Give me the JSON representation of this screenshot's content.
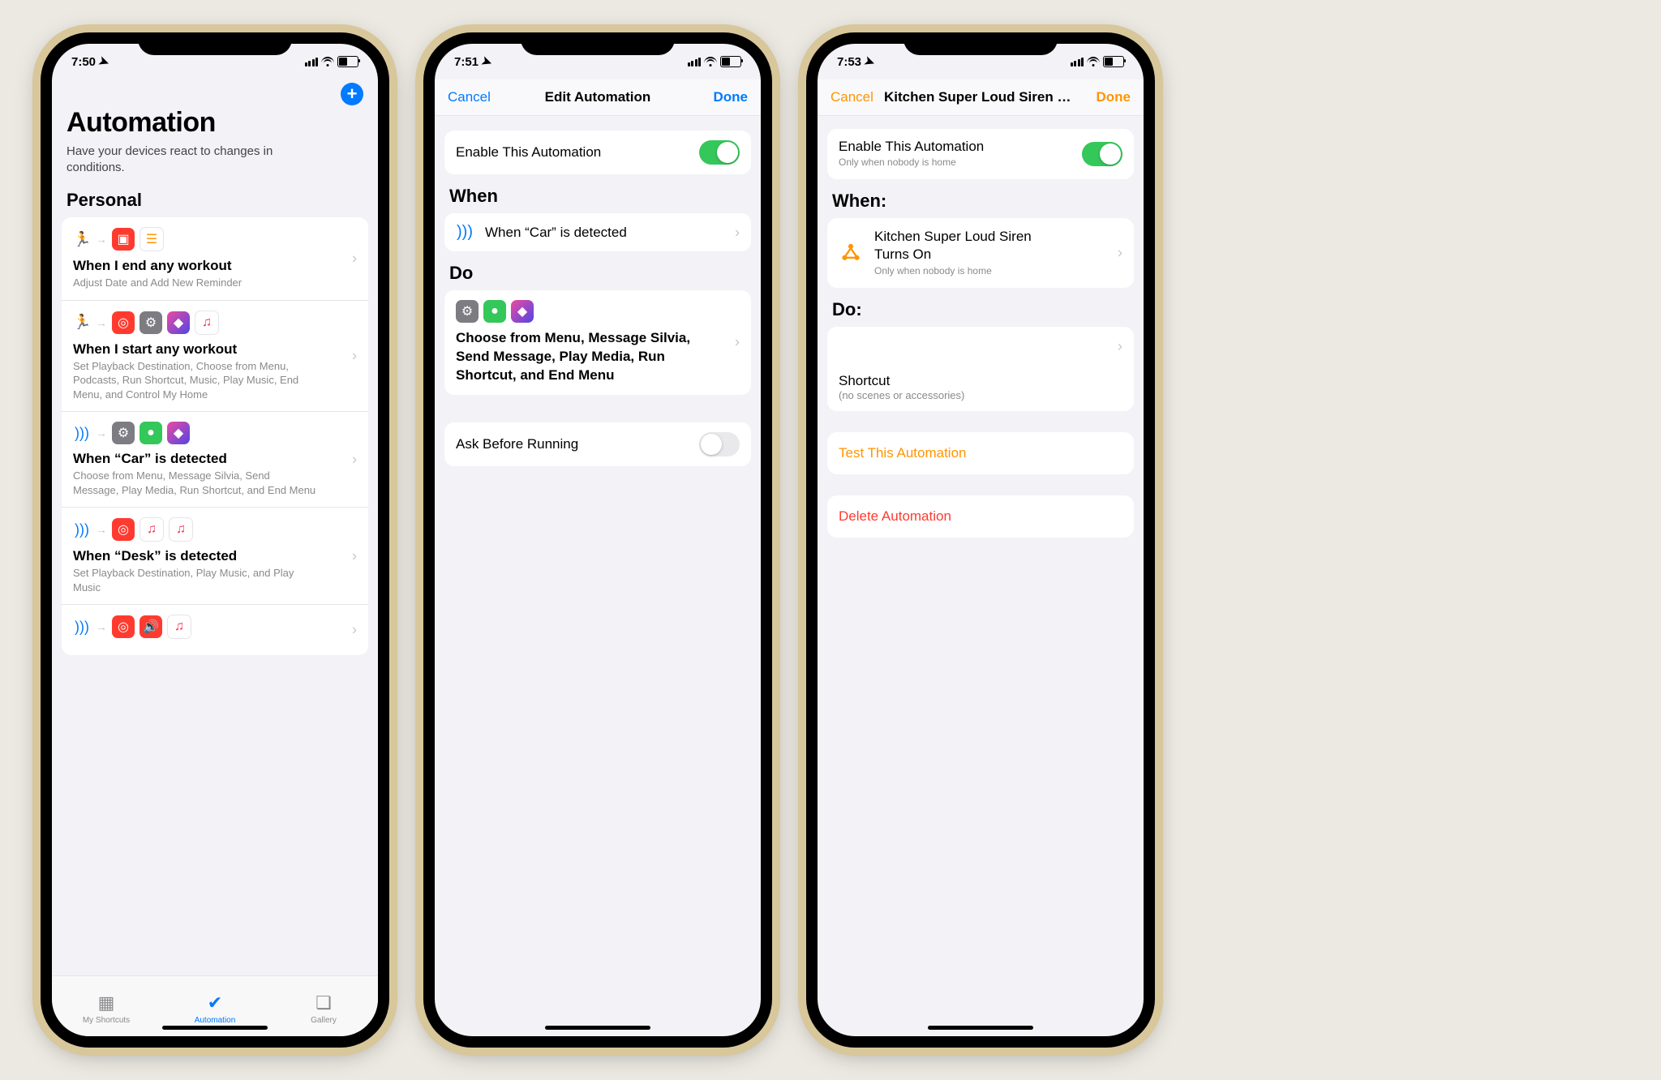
{
  "phone1": {
    "time": "7:50",
    "header_title": "Automation",
    "header_sub": "Have your devices react to changes in conditions.",
    "section": "Personal",
    "items": [
      {
        "title": "When I end any workout",
        "sub": "Adjust Date and Add New Reminder",
        "trigger": "runner",
        "apps": [
          "calendar",
          "reminders"
        ]
      },
      {
        "title": "When I start any workout",
        "sub": "Set Playback Destination, Choose from Menu, Podcasts, Run Shortcut, Music, Play Music, End Menu, and Control My Home",
        "trigger": "runner",
        "apps": [
          "airplay",
          "settings",
          "shortcuts",
          "music"
        ]
      },
      {
        "title": "When “Car” is detected",
        "sub": "Choose from Menu, Message Silvia, Send Message, Play Media, Run Shortcut, and End Menu",
        "trigger": "nfc",
        "apps": [
          "settings",
          "messages",
          "shortcuts"
        ]
      },
      {
        "title": "When “Desk” is detected",
        "sub": "Set Playback Destination, Play Music, and Play Music",
        "trigger": "nfc",
        "apps": [
          "airplay",
          "music",
          "music"
        ]
      },
      {
        "title": "",
        "sub": "",
        "trigger": "nfc",
        "apps": [
          "airplay",
          "sound",
          "music"
        ]
      }
    ],
    "tabs": {
      "shortcuts": "My Shortcuts",
      "automation": "Automation",
      "gallery": "Gallery"
    }
  },
  "phone2": {
    "time": "7:51",
    "cancel": "Cancel",
    "title": "Edit Automation",
    "done": "Done",
    "enable_label": "Enable This Automation",
    "when_h": "When",
    "when_text": "When “Car” is detected",
    "do_h": "Do",
    "do_text": "Choose from Menu, Message Silvia, Send Message, Play Media, Run Shortcut, and End Menu",
    "ask_label": "Ask Before Running"
  },
  "phone3": {
    "time": "7:53",
    "cancel": "Cancel",
    "title": "Kitchen Super Loud Siren Turn…",
    "done": "Done",
    "enable_label": "Enable This Automation",
    "enable_sub": "Only when nobody is home",
    "when_h": "When:",
    "when_title": "Kitchen Super Loud Siren Turns On",
    "when_sub": "Only when nobody is home",
    "do_h": "Do:",
    "shortcut_title": "Shortcut",
    "shortcut_sub": "(no scenes or accessories)",
    "test": "Test This Automation",
    "delete": "Delete Automation"
  },
  "icons": {
    "runner": "🏃",
    "nfc": ")))",
    "arrow": "→",
    "calendar": {
      "bg": "#ff3b30",
      "glyph": "▣"
    },
    "reminders": {
      "bg": "#fff",
      "border": true,
      "glyph": "☰",
      "color": "#ff9500"
    },
    "airplay": {
      "bg": "#ff3b30",
      "glyph": "◎"
    },
    "settings": {
      "bg": "#7c7c82",
      "glyph": "⚙"
    },
    "shortcuts": {
      "bg": "linear-gradient(135deg,#ed4aa1,#5046e5)",
      "glyph": "◆"
    },
    "music": {
      "bg": "#fff",
      "border": true,
      "glyph": "♫",
      "color": "#fa2d55"
    },
    "messages": {
      "bg": "#34c759",
      "glyph": "●"
    },
    "sound": {
      "bg": "#ff3b30",
      "glyph": "🔊"
    },
    "homekit": "▲"
  }
}
